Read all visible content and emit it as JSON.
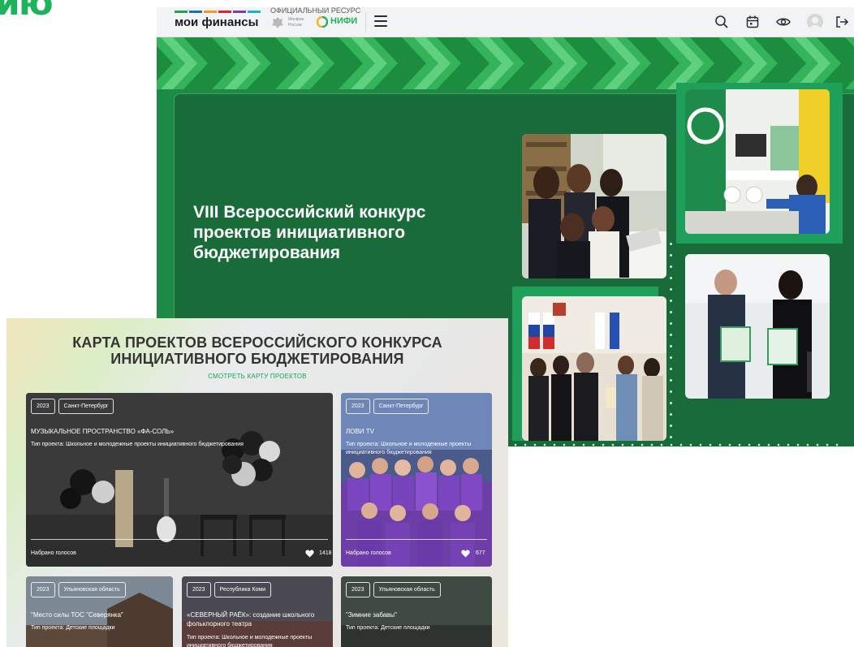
{
  "corner_logo": "ию",
  "site": {
    "logo_text": "мои финансы",
    "official_label": "ОФИЦИАЛЬНЫЙ РЕСУРС",
    "minfin_label": "Минфин России",
    "nifi_label": "НИФИ",
    "brand_stripe_colors": [
      "#26a04b",
      "#1f6fb8",
      "#f29a1d",
      "#d9262b",
      "#7b3ea1",
      "#18b5c9"
    ],
    "header_icons": [
      "search-icon",
      "calendar-icon",
      "eye-icon",
      "avatar",
      "logout-icon"
    ],
    "hero_title": "VIII Всероссийский конкурс проектов инициативного бюджетирования",
    "accent_color": "#1eb35a",
    "dark_green": "#1a6b3a"
  },
  "map_panel": {
    "title": "КАРТА ПРОЕКТОВ ВСЕРОССИЙСКОГО КОНКУРСА ИНИЦИАТИВНОГО БЮДЖЕТИРОВАНИЯ",
    "link_label": "СМОТРЕТЬ КАРТУ ПРОЕКТОВ",
    "votes_label": "Набрано голосов",
    "projects": [
      {
        "year": "2023",
        "region": "Санкт-Петербург",
        "title": "МУЗЫКАЛЬНОЕ ПРОСТРАНСТВО «ФА-СОЛЬ»",
        "type": "Тип проекта: Школьное и молодежные проекты инициативного бюджетирования",
        "votes": "1418"
      },
      {
        "year": "2023",
        "region": "Санкт-Петербург",
        "title": "ЛОВИ TV",
        "type": "Тип проекта: Школьное и молодежные проекты инициативного бюджетирования",
        "votes": "677"
      },
      {
        "year": "2023",
        "region": "Ульяновская область",
        "title": "\"Место силы ТОС \"Северянка\"",
        "type": "Тип проекта: Детские площадки"
      },
      {
        "year": "2023",
        "region": "Республика Коми",
        "title": "«СЕВЕРНЫЙ РАЁК»: создание школьного фольклорного театра",
        "type": "Тип проекта: Школьное и молодежные проекты инициативного бюджетирования"
      },
      {
        "year": "2023",
        "region": "Ульяновская область",
        "title": "\"Зимние забавы\"",
        "type": "Тип проекта: Детские площадки"
      }
    ]
  }
}
